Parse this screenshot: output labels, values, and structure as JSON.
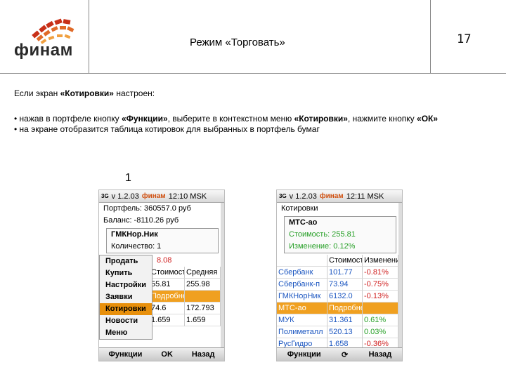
{
  "header": {
    "logo": "финам",
    "title": "Режим «Торговать»",
    "page_number": "17"
  },
  "intro": {
    "pre": "Если экран ",
    "bold": "«Котировки»",
    "post": " настроен:"
  },
  "bullets": [
    {
      "t1": "• нажав в портфеле кнопку ",
      "b1": "«Функции»",
      "t2": ", выберите в контекстном  меню ",
      "b2": "«Котировки»",
      "t3": ", нажмите кнопку ",
      "b3": "«ОК»",
      "t4": ""
    },
    {
      "t1": "• на экране отобразится таблица котировок для выбранных в портфель бумаг",
      "b1": "",
      "t2": "",
      "b2": "",
      "t3": "",
      "b3": "",
      "t4": ""
    }
  ],
  "figure_number": "1",
  "phone1": {
    "status": {
      "signal": "3G",
      "version": "v 1.2.03",
      "brand": "финам",
      "time": "12:10 MSK"
    },
    "portfolio": "Портфель: 360557.0 руб",
    "balance": "Баланс: -8110.26 руб",
    "ticker": "ГМКНор.Ник",
    "qty": "Количество: 1",
    "price_partial": "8.08",
    "table_header": [
      "",
      "Стоимость",
      "Средняя"
    ],
    "rows": [
      [
        "",
        "55.81",
        "255.98"
      ],
      [
        "",
        "Подробнее ▸",
        ""
      ],
      [
        "",
        "74.6",
        "172.793"
      ],
      [
        "",
        "1.659",
        "1.659"
      ]
    ],
    "menu": [
      "Продать",
      "Купить",
      "Настройки",
      "Заявки",
      "Котировки",
      "Новости",
      "Меню"
    ],
    "menu_selected": 4,
    "buttons": [
      "Функции",
      "OK",
      "Назад"
    ]
  },
  "phone2": {
    "status": {
      "signal": "3G",
      "version": "v 1.2.03",
      "brand": "финам",
      "time": "12:11 MSK"
    },
    "title": "Котировки",
    "ticker": "МТС-ао",
    "cost": "Стоимость: 255.81",
    "change": "Изменение: 0.12%",
    "table_header": [
      "",
      "Стоимость",
      "Изменение"
    ],
    "rows": [
      [
        "Сбербанк",
        "101.77",
        "-0.81%"
      ],
      [
        "Сбербанк-п",
        "73.94",
        "-0.75%"
      ],
      [
        "ГМКНорНик",
        "6132.0",
        "-0.13%"
      ],
      [
        "МТС-ао",
        "Подробнее ▸",
        ""
      ],
      [
        "МУК",
        "31.361",
        "0.61%"
      ],
      [
        "Полиметалл",
        "520.13",
        "0.03%"
      ],
      [
        "РусГидро",
        "1.658",
        "-0.36%"
      ]
    ],
    "buttons": [
      "Функции",
      "⟳",
      "Назад"
    ]
  }
}
